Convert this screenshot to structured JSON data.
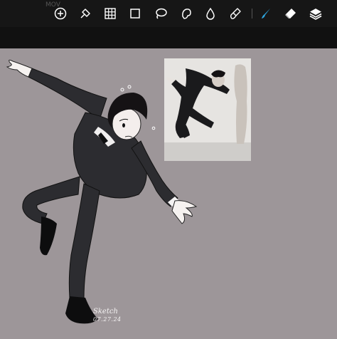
{
  "toolbar": {
    "tools": [
      {
        "name": "add-icon"
      },
      {
        "name": "adjust-icon"
      },
      {
        "name": "grid-icon"
      },
      {
        "name": "selection-rect-icon"
      },
      {
        "name": "lasso-icon"
      },
      {
        "name": "smudge-icon"
      },
      {
        "name": "liquify-icon"
      },
      {
        "name": "gear-icon"
      },
      {
        "name": "brush-icon",
        "active": true
      },
      {
        "name": "eraser-icon"
      },
      {
        "name": "layers-icon"
      }
    ],
    "active_color": "#2ea7e0"
  },
  "tab_strip": {
    "hint": "MOV"
  },
  "canvas": {
    "background_color": "#9d9699",
    "signature": {
      "name": "Sketch",
      "date": "07.27.24"
    }
  }
}
